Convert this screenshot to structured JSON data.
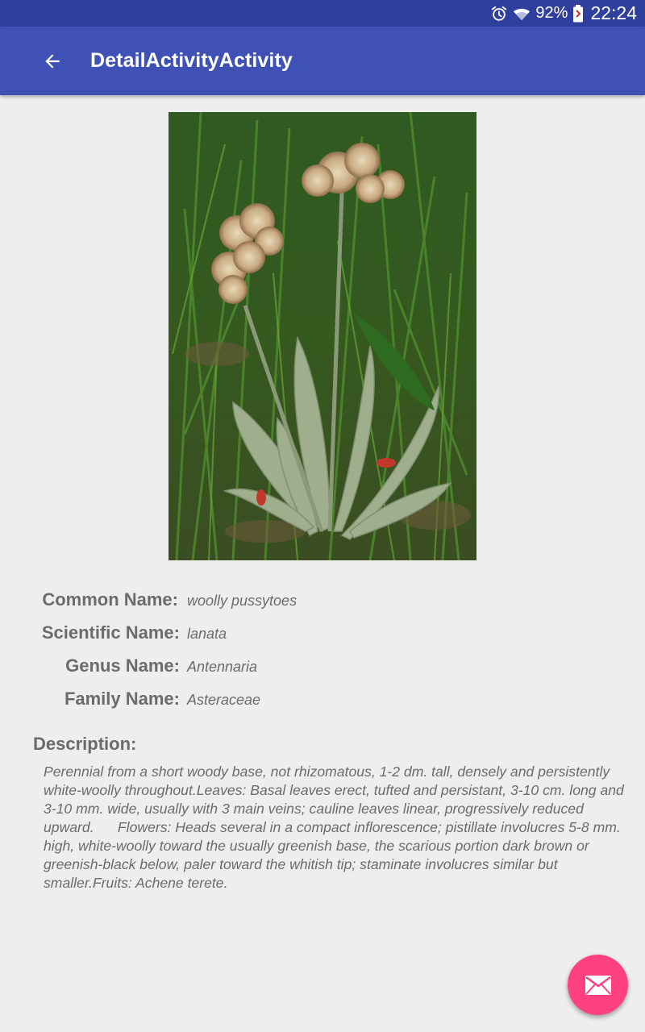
{
  "status_bar": {
    "battery_percent": "92%",
    "time": "22:24",
    "icons": [
      "alarm-icon",
      "wifi-icon",
      "battery-icon"
    ]
  },
  "app_bar": {
    "title": "DetailActivityActivity",
    "back_icon": "arrow-back-icon"
  },
  "plant": {
    "image_icon": "plant-photo",
    "fields": [
      {
        "label": "Common Name:",
        "value": "woolly pussytoes"
      },
      {
        "label": "Scientific Name:",
        "value": "lanata"
      },
      {
        "label": "Genus Name:",
        "value": "Antennaria"
      },
      {
        "label": "Family Name:",
        "value": "Asteraceae"
      }
    ],
    "description_label": "Description:",
    "description": "Perennial from a short woody base, not rhizomatous, 1-2 dm. tall, densely and persistently white-woolly throughout.Leaves: Basal leaves erect, tufted and persistant, 3-10 cm. long and 3-10 mm. wide, usually with 3 main veins; cauline leaves linear, progressively reduced upward.      Flowers: Heads several in a compact inflorescence; pistillate involucres 5-8 mm. high, white-woolly toward the usually greenish base, the scarious portion dark brown or greenish-black below, paler toward the whitish tip; staminate involucres similar but smaller.Fruits: Achene terete."
  },
  "fab": {
    "icon": "mail-icon"
  },
  "colors": {
    "primary": "#3f51b5",
    "primary_dark": "#2f3f9e",
    "accent": "#ff4081",
    "background": "#eeeeee"
  }
}
